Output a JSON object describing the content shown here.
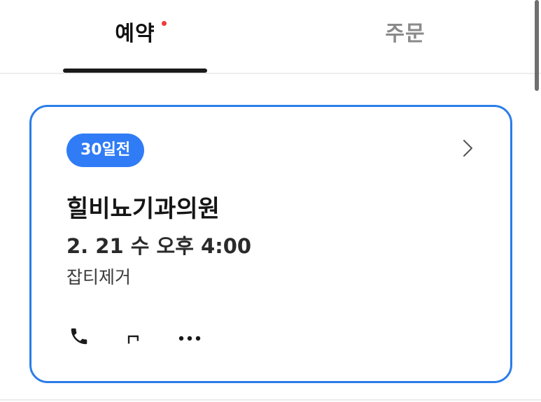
{
  "tabs": {
    "reservation_label": "예약",
    "order_label": "주문"
  },
  "card": {
    "badge": "30일전",
    "clinic_name": "힐비뇨기과의원",
    "datetime": "2. 21 수 오후 4:00",
    "service": "잡티제거"
  },
  "icons": {
    "chevron": "chevron-right-icon",
    "call": "phone-icon",
    "direction": "turn-right-arrow-icon",
    "more": "more-horizontal-icon"
  },
  "colors": {
    "accent": "#2f7cf6",
    "card_border": "#2a7de8",
    "notification_dot": "#f03a3a",
    "active_tab": "#111111",
    "inactive_tab": "#8a8a8a"
  }
}
